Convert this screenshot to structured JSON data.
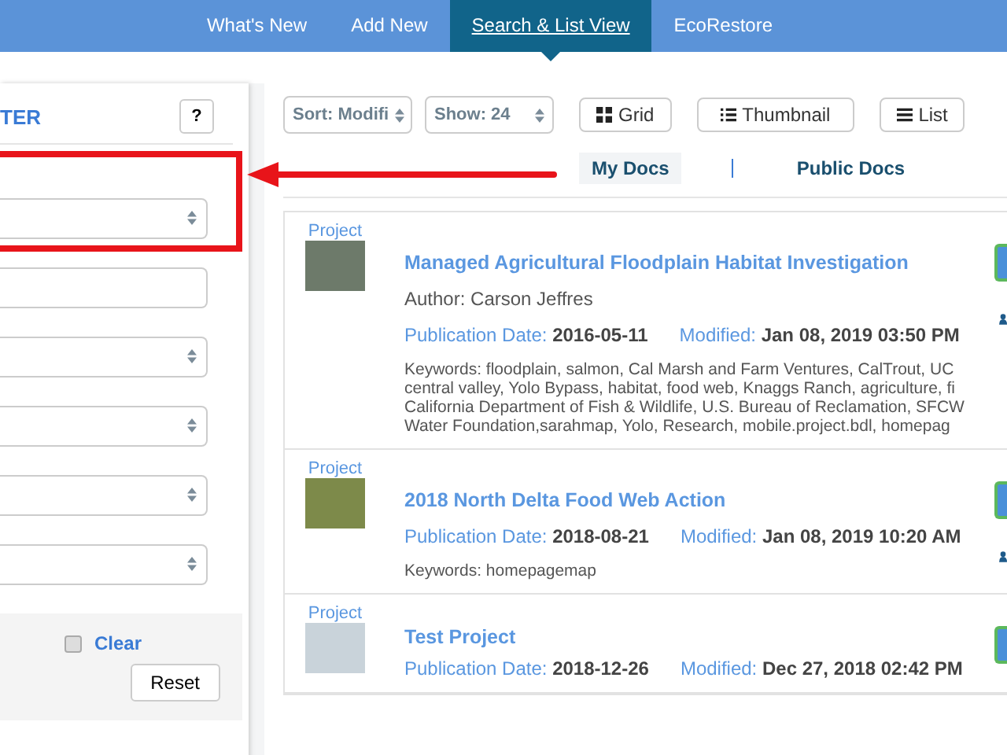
{
  "nav": {
    "tabs": [
      {
        "label": "What's New",
        "selected": false
      },
      {
        "label": "Add New",
        "selected": false
      },
      {
        "label": "Search & List View",
        "selected": true
      },
      {
        "label": "EcoRestore",
        "selected": false
      }
    ]
  },
  "filter": {
    "title": "TER",
    "help": "?",
    "fields": [
      {
        "kind": "select",
        "highlighted": true
      },
      {
        "kind": "input",
        "highlighted": false
      },
      {
        "kind": "select",
        "highlighted": false
      },
      {
        "kind": "select",
        "highlighted": false
      },
      {
        "kind": "select",
        "highlighted": false
      },
      {
        "kind": "select",
        "highlighted": false
      }
    ],
    "clear_checked": false,
    "clear": "Clear",
    "reset": "Reset"
  },
  "toolbar": {
    "sort": "Sort: Modifi",
    "show": "Show: 24",
    "views": [
      {
        "kind": "grid",
        "label": "Grid"
      },
      {
        "kind": "thumbnail",
        "label": "Thumbnail"
      },
      {
        "kind": "list",
        "label": "List"
      }
    ]
  },
  "doc_tabs": [
    {
      "label": "My Docs",
      "selected": true
    },
    {
      "label": "Public Docs",
      "selected": false
    }
  ],
  "results": [
    {
      "type": "Project",
      "title": "Managed Agricultural Floodplain Habitat Investigation",
      "author": "Author: Carson Jeffres",
      "pub_label": "Publication Date:",
      "pub_date": "2016-05-11",
      "mod_label": "Modified:",
      "modified": "Jan 08, 2019 03:50 PM",
      "keywords": [
        "Keywords: floodplain, salmon, Cal Marsh and Farm Ventures, CalTrout, UC",
        "central valley, Yolo Bypass, habitat, food web, Knaggs Ranch, agriculture, fi",
        "California Department of Fish & Wildlife, U.S. Bureau of Reclamation, SFCW",
        "Water Foundation,sarahmap, Yolo, Research, mobile.project.bdl, homepag"
      ]
    },
    {
      "type": "Project",
      "title": "2018 North Delta Food Web Action",
      "pub_label": "Publication Date:",
      "pub_date": "2018-08-21",
      "mod_label": "Modified:",
      "modified": "Jan 08, 2019 10:20 AM",
      "keywords": [
        "Keywords: homepagemap"
      ]
    },
    {
      "type": "Project",
      "title": "Test Project",
      "pub_label": "Publication Date:",
      "pub_date": "2018-12-26",
      "mod_label": "Modified:",
      "modified": "Dec 27, 2018 02:42 PM"
    }
  ]
}
